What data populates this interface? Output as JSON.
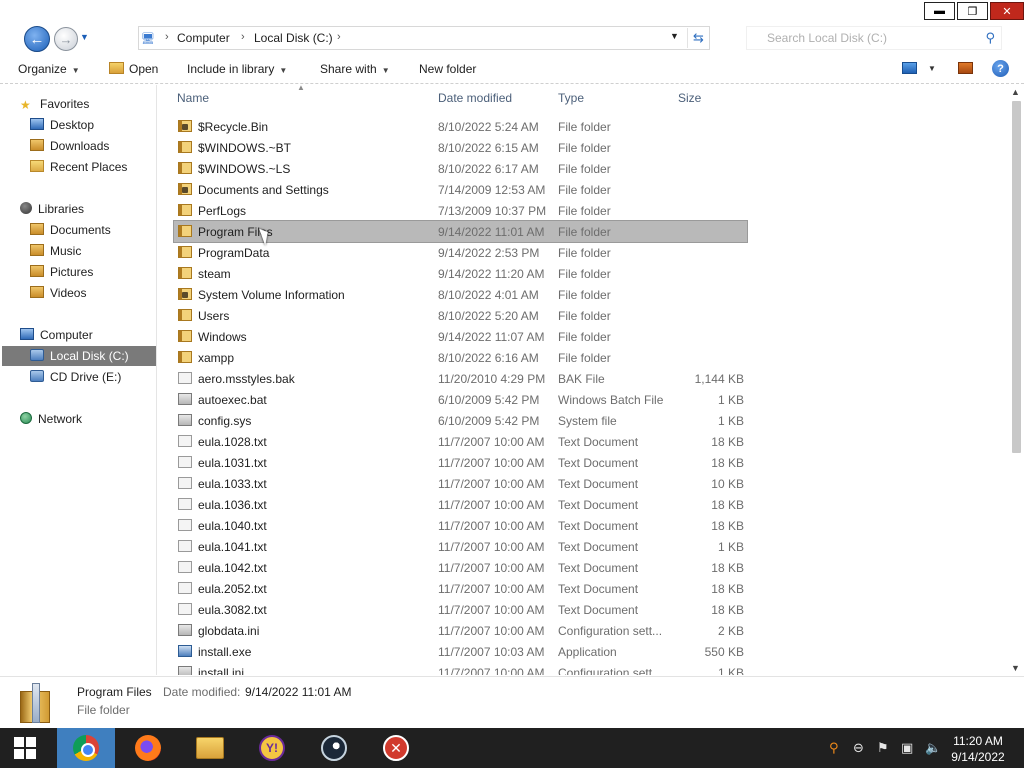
{
  "window": {
    "minimize": "▬",
    "restore": "❐",
    "close": "✕"
  },
  "address": {
    "crumbs": [
      "Computer",
      "Local Disk (C:)"
    ],
    "search_placeholder": "Search Local Disk (C:)"
  },
  "toolbar": {
    "organize": "Organize",
    "open": "Open",
    "include_in_library": "Include in library",
    "share_with": "Share with",
    "new_folder": "New folder",
    "help": "?"
  },
  "nav": {
    "favorites": "Favorites",
    "favorites_items": [
      "Desktop",
      "Downloads",
      "Recent Places"
    ],
    "libraries": "Libraries",
    "libraries_items": [
      "Documents",
      "Music",
      "Pictures",
      "Videos"
    ],
    "computer": "Computer",
    "computer_items": [
      "Local Disk (C:)",
      "CD Drive (E:)"
    ],
    "network": "Network"
  },
  "columns": {
    "name": "Name",
    "date": "Date modified",
    "type": "Type",
    "size": "Size"
  },
  "files": [
    {
      "name": "$Recycle.Bin",
      "date": "8/10/2022 5:24 AM",
      "type": "File folder",
      "size": "",
      "icon": "lock-folder-icon"
    },
    {
      "name": "$WINDOWS.~BT",
      "date": "8/10/2022 6:15 AM",
      "type": "File folder",
      "size": "",
      "icon": "folder-icon"
    },
    {
      "name": "$WINDOWS.~LS",
      "date": "8/10/2022 6:17 AM",
      "type": "File folder",
      "size": "",
      "icon": "folder-icon"
    },
    {
      "name": "Documents and Settings",
      "date": "7/14/2009 12:53 AM",
      "type": "File folder",
      "size": "",
      "icon": "lock-folder-icon"
    },
    {
      "name": "PerfLogs",
      "date": "7/13/2009 10:37 PM",
      "type": "File folder",
      "size": "",
      "icon": "folder-icon"
    },
    {
      "name": "Program Files",
      "date": "9/14/2022 11:01 AM",
      "type": "File folder",
      "size": "",
      "icon": "folder-icon",
      "selected": true
    },
    {
      "name": "ProgramData",
      "date": "9/14/2022 2:53 PM",
      "type": "File folder",
      "size": "",
      "icon": "folder-icon"
    },
    {
      "name": "steam",
      "date": "9/14/2022 11:20 AM",
      "type": "File folder",
      "size": "",
      "icon": "folder-icon"
    },
    {
      "name": "System Volume Information",
      "date": "8/10/2022 4:01 AM",
      "type": "File folder",
      "size": "",
      "icon": "lock-folder-icon"
    },
    {
      "name": "Users",
      "date": "8/10/2022 5:20 AM",
      "type": "File folder",
      "size": "",
      "icon": "folder-icon"
    },
    {
      "name": "Windows",
      "date": "9/14/2022 11:07 AM",
      "type": "File folder",
      "size": "",
      "icon": "folder-icon"
    },
    {
      "name": "xampp",
      "date": "8/10/2022 6:16 AM",
      "type": "File folder",
      "size": "",
      "icon": "folder-icon"
    },
    {
      "name": "aero.msstyles.bak",
      "date": "11/20/2010 4:29 PM",
      "type": "BAK File",
      "size": "1,144 KB",
      "icon": "file-icon"
    },
    {
      "name": "autoexec.bat",
      "date": "6/10/2009 5:42 PM",
      "type": "Windows Batch File",
      "size": "1 KB",
      "icon": "config-file-icon"
    },
    {
      "name": "config.sys",
      "date": "6/10/2009 5:42 PM",
      "type": "System file",
      "size": "1 KB",
      "icon": "config-file-icon"
    },
    {
      "name": "eula.1028.txt",
      "date": "11/7/2007 10:00 AM",
      "type": "Text Document",
      "size": "18 KB",
      "icon": "text-file-icon"
    },
    {
      "name": "eula.1031.txt",
      "date": "11/7/2007 10:00 AM",
      "type": "Text Document",
      "size": "18 KB",
      "icon": "text-file-icon"
    },
    {
      "name": "eula.1033.txt",
      "date": "11/7/2007 10:00 AM",
      "type": "Text Document",
      "size": "10 KB",
      "icon": "text-file-icon"
    },
    {
      "name": "eula.1036.txt",
      "date": "11/7/2007 10:00 AM",
      "type": "Text Document",
      "size": "18 KB",
      "icon": "text-file-icon"
    },
    {
      "name": "eula.1040.txt",
      "date": "11/7/2007 10:00 AM",
      "type": "Text Document",
      "size": "18 KB",
      "icon": "text-file-icon"
    },
    {
      "name": "eula.1041.txt",
      "date": "11/7/2007 10:00 AM",
      "type": "Text Document",
      "size": "1 KB",
      "icon": "text-file-icon"
    },
    {
      "name": "eula.1042.txt",
      "date": "11/7/2007 10:00 AM",
      "type": "Text Document",
      "size": "18 KB",
      "icon": "text-file-icon"
    },
    {
      "name": "eula.2052.txt",
      "date": "11/7/2007 10:00 AM",
      "type": "Text Document",
      "size": "18 KB",
      "icon": "text-file-icon"
    },
    {
      "name": "eula.3082.txt",
      "date": "11/7/2007 10:00 AM",
      "type": "Text Document",
      "size": "18 KB",
      "icon": "text-file-icon"
    },
    {
      "name": "globdata.ini",
      "date": "11/7/2007 10:00 AM",
      "type": "Configuration sett...",
      "size": "2 KB",
      "icon": "config-file-icon"
    },
    {
      "name": "install.exe",
      "date": "11/7/2007 10:03 AM",
      "type": "Application",
      "size": "550 KB",
      "icon": "exe-icon"
    },
    {
      "name": "install.ini",
      "date": "11/7/2007 10:00 AM",
      "type": "Configuration sett...",
      "size": "1 KB",
      "icon": "config-file-icon"
    }
  ],
  "details": {
    "name": "Program Files",
    "date_label": "Date modified:",
    "date_value": "9/14/2022 11:01 AM",
    "type": "File folder"
  },
  "taskbar": {
    "apps": [
      "chrome-icon",
      "firefox-icon",
      "file-explorer-icon",
      "yahoo-messenger-icon",
      "steam-icon",
      "error-icon"
    ],
    "active_app": "chrome-icon",
    "clock_time": "11:20 AM",
    "clock_date": "9/14/2022"
  },
  "colors": {
    "selection": "#b9b9b9",
    "taskbar": "#202020",
    "active_app": "#3f7fbf",
    "nav_selected": "#7a7a7a"
  }
}
